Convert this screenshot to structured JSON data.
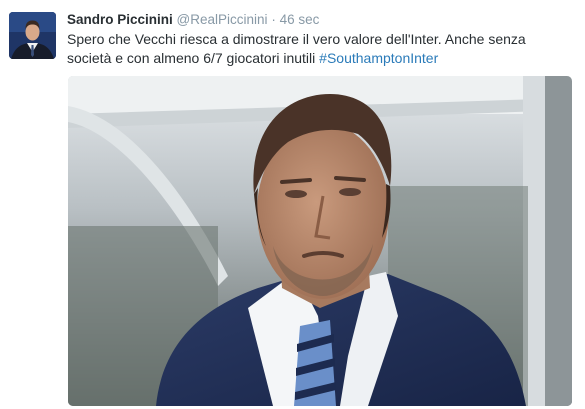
{
  "tweet": {
    "author_name": "Sandro Piccinini",
    "handle": "@RealPiccinini",
    "separator": "·",
    "time": "46 sec",
    "text_before_hashtag": "Spero che Vecchi riesca a dimostrare il vero valore dell'Inter. Anche senza società e con almeno 6/7 giocatori inutili ",
    "hashtag": "#SouthamptonInter"
  },
  "icons": {
    "avatar": "profile-photo",
    "media": "photo-of-man-in-suit"
  },
  "colors": {
    "name": "#292f33",
    "muted": "#8899a6",
    "link": "#2b7bb9",
    "text": "#292f33"
  }
}
